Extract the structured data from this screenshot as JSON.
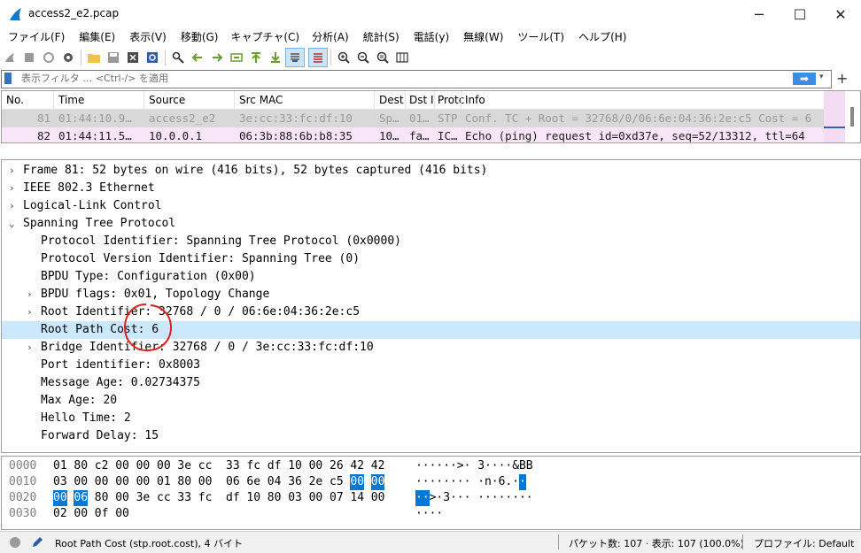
{
  "window": {
    "title": "access2_e2.pcap",
    "minimize": "─",
    "maximize": "☐",
    "close": "✕"
  },
  "menu": [
    "ファイル(F)",
    "編集(E)",
    "表示(V)",
    "移動(G)",
    "キャプチャ(C)",
    "分析(A)",
    "統計(S)",
    "電話(y)",
    "無線(W)",
    "ツール(T)",
    "ヘルプ(H)"
  ],
  "filter": {
    "placeholder": "表示フィルタ … <Ctrl-/> を適用",
    "apply_icon": "arrow-right-icon",
    "dropdown": "▾",
    "add": "+"
  },
  "packet_list": {
    "columns": [
      "No.",
      "Time",
      "Source",
      "Src MAC",
      "Dest",
      "Dst I",
      "Protc",
      "Info"
    ],
    "rows": [
      {
        "no": "81",
        "time": "01:44:10.9…",
        "source": "access2_e2",
        "src_mac": "3e:cc:33:fc:df:10",
        "dest": "Sp…",
        "dst": "01…",
        "proto": "STP",
        "info": "Conf. TC + Root = 32768/0/06:6e:04:36:2e:c5  Cost = 6"
      },
      {
        "no": "82",
        "time": "01:44:11.5…",
        "source": "10.0.0.1",
        "src_mac": "06:3b:88:6b:b8:35",
        "dest": "10…",
        "dst": "fa…",
        "proto": "IC…",
        "info": "Echo (ping) request  id=0xd37e, seq=52/13312, ttl=64"
      }
    ]
  },
  "details": [
    {
      "text": "Frame 81: 52 bytes on wire (416 bits), 52 bytes captured (416 bits)",
      "indent": 0,
      "arrow": "›"
    },
    {
      "text": "IEEE 802.3 Ethernet",
      "indent": 0,
      "arrow": "›"
    },
    {
      "text": "Logical-Link Control",
      "indent": 0,
      "arrow": "›"
    },
    {
      "text": "Spanning Tree Protocol",
      "indent": 0,
      "arrow": "⌄"
    },
    {
      "text": "Protocol Identifier: Spanning Tree Protocol (0x0000)",
      "indent": 1,
      "arrow": ""
    },
    {
      "text": "Protocol Version Identifier: Spanning Tree (0)",
      "indent": 1,
      "arrow": ""
    },
    {
      "text": "BPDU Type: Configuration (0x00)",
      "indent": 1,
      "arrow": ""
    },
    {
      "text": "BPDU flags: 0x01, Topology Change",
      "indent": 1,
      "arrow": "›"
    },
    {
      "text": "Root Identifier: 32768 / 0 / 06:6e:04:36:2e:c5",
      "indent": 1,
      "arrow": "›"
    },
    {
      "text": "Root Path Cost: 6",
      "indent": 1,
      "arrow": "",
      "selected": true
    },
    {
      "text": "Bridge Identifier: 32768 / 0 / 3e:cc:33:fc:df:10",
      "indent": 1,
      "arrow": "›"
    },
    {
      "text": "Port identifier: 0x8003",
      "indent": 1,
      "arrow": ""
    },
    {
      "text": "Message Age: 0.02734375",
      "indent": 1,
      "arrow": ""
    },
    {
      "text": "Max Age: 20",
      "indent": 1,
      "arrow": ""
    },
    {
      "text": "Hello Time: 2",
      "indent": 1,
      "arrow": ""
    },
    {
      "text": "Forward Delay: 15",
      "indent": 1,
      "arrow": ""
    }
  ],
  "hex": [
    {
      "offset": "0000",
      "bytes": [
        "01",
        "80",
        "c2",
        "00",
        "00",
        "00",
        "3e",
        "cc",
        "33",
        "fc",
        "df",
        "10",
        "00",
        "26",
        "42",
        "42"
      ],
      "hl": [],
      "ascii": "······>· 3····&BB",
      "ascii_hl": []
    },
    {
      "offset": "0010",
      "bytes": [
        "03",
        "00",
        "00",
        "00",
        "00",
        "01",
        "80",
        "00",
        "06",
        "6e",
        "04",
        "36",
        "2e",
        "c5",
        "00",
        "00"
      ],
      "hl": [
        14,
        15
      ],
      "ascii": "········ ·n·6.··",
      "ascii_hl": [
        15,
        16
      ]
    },
    {
      "offset": "0020",
      "bytes": [
        "00",
        "06",
        "80",
        "00",
        "3e",
        "cc",
        "33",
        "fc",
        "df",
        "10",
        "80",
        "03",
        "00",
        "07",
        "14",
        "00"
      ],
      "hl": [
        0,
        1
      ],
      "ascii": "··>·3··· ········",
      "ascii_hl": [
        0,
        1
      ]
    },
    {
      "offset": "0030",
      "bytes": [
        "02",
        "00",
        "0f",
        "00"
      ],
      "hl": [],
      "ascii": "····",
      "ascii_hl": []
    }
  ],
  "status": {
    "field_info": "Root Path Cost (stp.root.cost), 4 バイト",
    "packets": "パケット数: 107 · 表示: 107 (100.0%)",
    "profile": "プロファイル: Default"
  },
  "annotation_color": "#e0201c",
  "selection_color": "#cce8ff",
  "highlight_color": "#0078d7"
}
